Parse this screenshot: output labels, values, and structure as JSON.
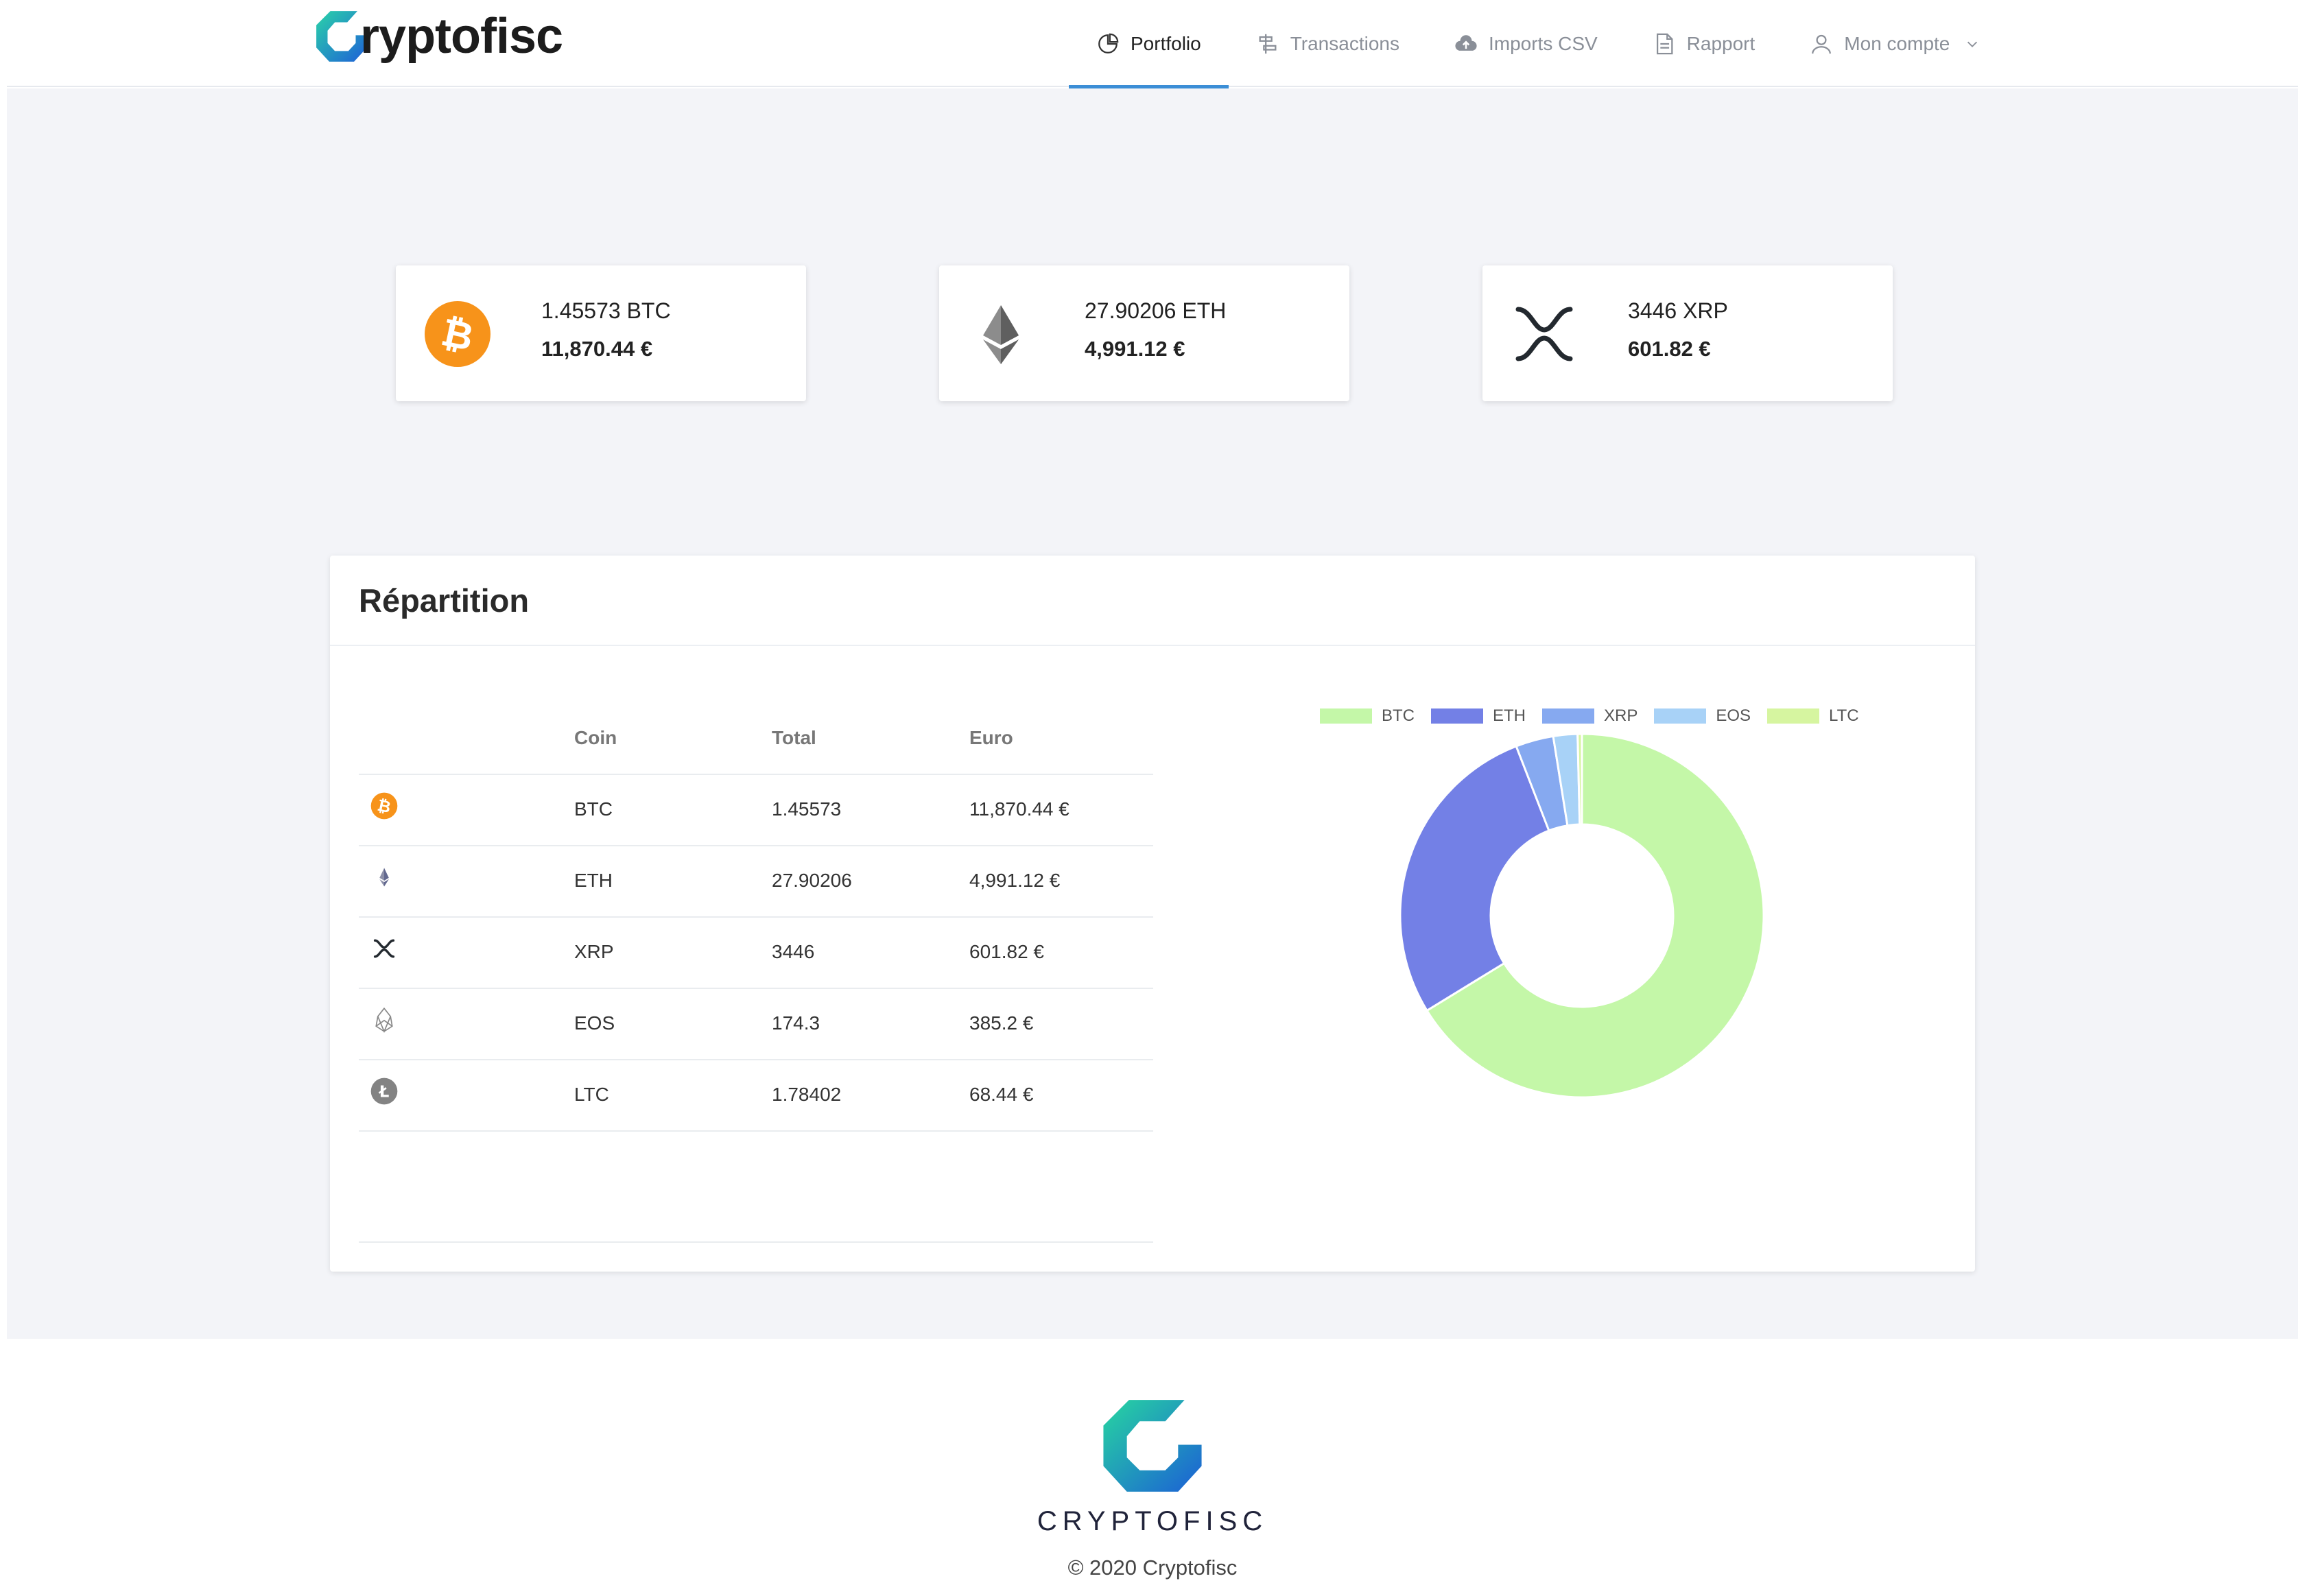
{
  "brand": {
    "logo_bold": "ryptofisc",
    "logo_light": ""
  },
  "nav": {
    "items": [
      {
        "label": "Portfolio",
        "icon": "pie-chart-icon",
        "active": true
      },
      {
        "label": "Transactions",
        "icon": "transactions-icon",
        "active": false
      },
      {
        "label": "Imports CSV",
        "icon": "cloud-upload-icon",
        "active": false
      },
      {
        "label": "Rapport",
        "icon": "document-icon",
        "active": false
      },
      {
        "label": "Mon compte",
        "icon": "user-icon",
        "active": false
      }
    ]
  },
  "cards": [
    {
      "coin": "BTC",
      "amount": "1.45573 BTC",
      "euro": "11,870.44 €",
      "icon": "bitcoin-icon",
      "color": "#f7931a"
    },
    {
      "coin": "ETH",
      "amount": "27.90206 ETH",
      "euro": "4,991.12 €",
      "icon": "ethereum-icon",
      "color": "#62688f"
    },
    {
      "coin": "XRP",
      "amount": "3446 XRP",
      "euro": "601.82 €",
      "icon": "xrp-icon",
      "color": "#23292f"
    }
  ],
  "repartition": {
    "title": "Répartition",
    "columns": {
      "coin": "Coin",
      "total": "Total",
      "euro": "Euro"
    },
    "rows": [
      {
        "icon": "bitcoin-icon",
        "coin": "BTC",
        "total": "1.45573",
        "euro": "11,870.44 €"
      },
      {
        "icon": "ethereum-icon",
        "coin": "ETH",
        "total": "27.90206",
        "euro": "4,991.12 €"
      },
      {
        "icon": "xrp-icon",
        "coin": "XRP",
        "total": "3446",
        "euro": "601.82 €"
      },
      {
        "icon": "eos-icon",
        "coin": "EOS",
        "total": "174.3",
        "euro": "385.2 €"
      },
      {
        "icon": "litecoin-icon",
        "coin": "LTC",
        "total": "1.78402",
        "euro": "68.44 €"
      }
    ]
  },
  "chart_data": {
    "type": "pie",
    "donut": true,
    "categories": [
      "BTC",
      "ETH",
      "XRP",
      "EOS",
      "LTC"
    ],
    "values": [
      11870.44,
      4991.12,
      601.82,
      385.2,
      68.44
    ],
    "colors": [
      "#c4f7a8",
      "#7380e6",
      "#86a9f0",
      "#a8d2f7",
      "#d6f5a0"
    ],
    "legend_position": "top"
  },
  "footer": {
    "brand_a": "CRYPTO",
    "brand_b": "FISC",
    "copyright": "© 2020 Cryptofisc"
  }
}
